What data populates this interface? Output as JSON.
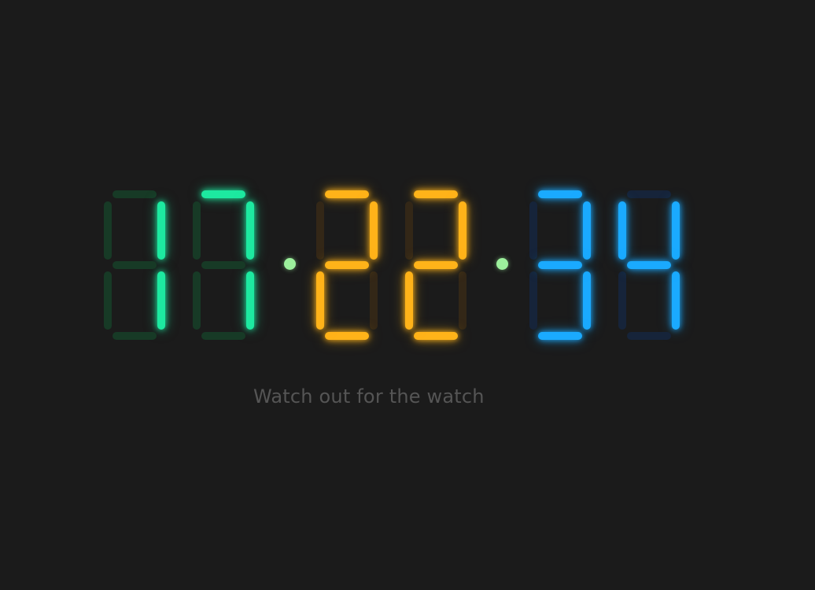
{
  "clock": {
    "hours": "17",
    "minutes": "22",
    "seconds": "34",
    "colors": {
      "hours": "#1de9a0",
      "minutes": "#ffb319",
      "seconds": "#1aaaff",
      "separator": "#9cf09c",
      "hours_off": "#173a26",
      "minutes_off": "#332717",
      "seconds_off": "#16243a",
      "background": "#1b1b1b"
    }
  },
  "tagline": "Watch out for the watch"
}
